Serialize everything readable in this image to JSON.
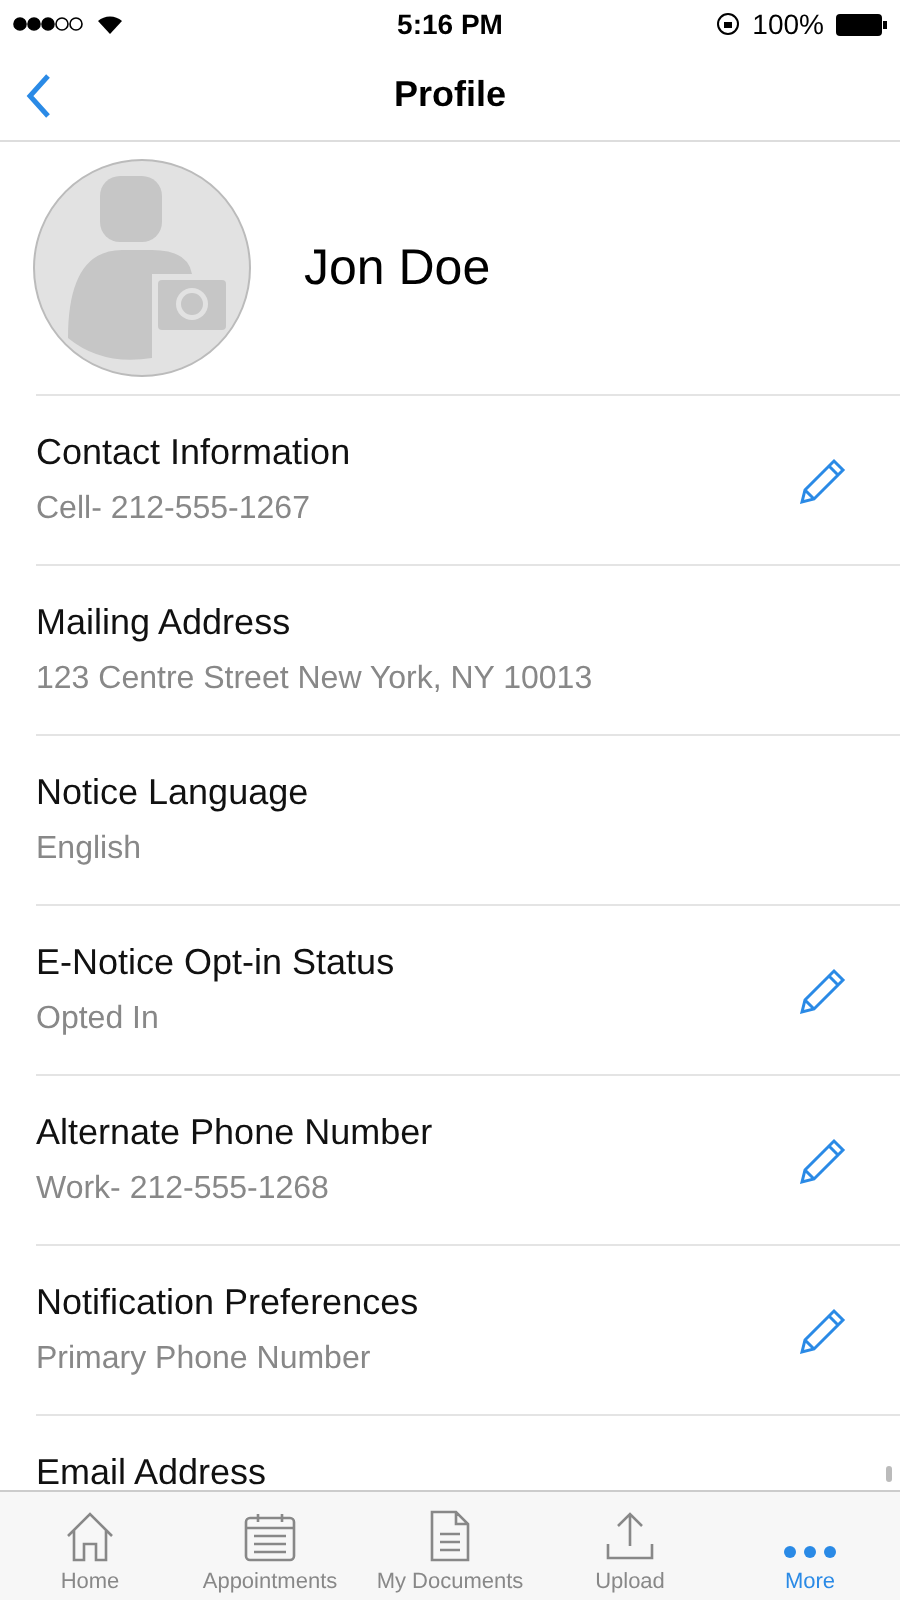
{
  "status_bar": {
    "time": "5:16 PM",
    "battery": "100%"
  },
  "nav": {
    "title": "Profile"
  },
  "profile": {
    "name": "Jon Doe"
  },
  "rows": [
    {
      "title": "Contact Information",
      "value": "Cell- 212-555-1267",
      "editable": true
    },
    {
      "title": "Mailing Address",
      "value": "123 Centre Street New York, NY 10013",
      "editable": false
    },
    {
      "title": "Notice Language",
      "value": "English",
      "editable": false
    },
    {
      "title": "E-Notice Opt-in Status",
      "value": "Opted In",
      "editable": true
    },
    {
      "title": "Alternate Phone Number",
      "value": "Work- 212-555-1268",
      "editable": true
    },
    {
      "title": "Notification Preferences",
      "value": "Primary Phone Number",
      "editable": true
    },
    {
      "title": "Email Address",
      "editable": false
    }
  ],
  "tabs": [
    {
      "label": "Home",
      "kind": "home",
      "selected": false
    },
    {
      "label": "Appointments",
      "kind": "calendar",
      "selected": false
    },
    {
      "label": "My Documents",
      "kind": "document",
      "selected": false
    },
    {
      "label": "Upload",
      "kind": "upload",
      "selected": false
    },
    {
      "label": "More",
      "kind": "more",
      "selected": true
    }
  ]
}
